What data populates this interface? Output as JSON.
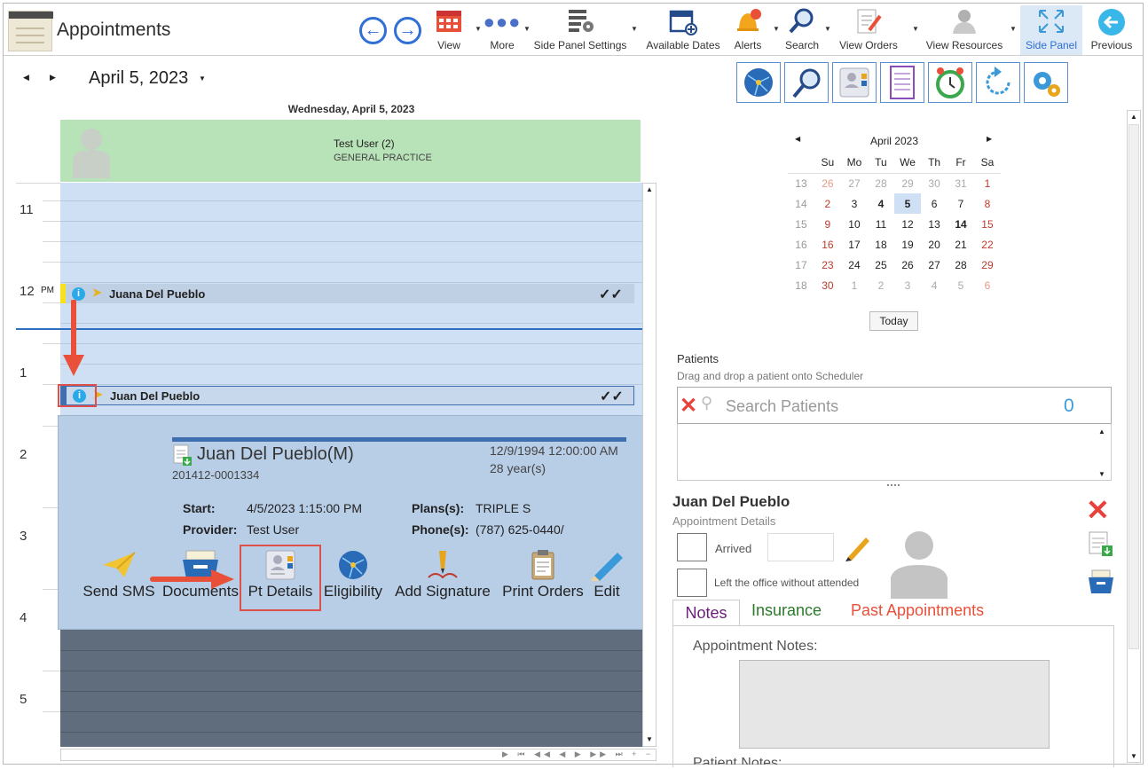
{
  "window": {
    "title": "Appointments"
  },
  "toolbar": {
    "items": [
      {
        "label": "View",
        "icon": "calendar-grid-icon"
      },
      {
        "label": "More",
        "icon": "more-dots-icon"
      },
      {
        "label": "Side Panel Settings",
        "icon": "grid-gear-icon"
      },
      {
        "label": "Available Dates",
        "icon": "calendar-add-icon"
      },
      {
        "label": "Alerts",
        "icon": "bell-icon"
      },
      {
        "label": "Search",
        "icon": "search-icon"
      },
      {
        "label": "View Orders",
        "icon": "document-edit-icon"
      },
      {
        "label": "View Resources",
        "icon": "person-icon"
      },
      {
        "label": "Side Panel",
        "icon": "expand-icon"
      },
      {
        "label": "Previous",
        "icon": "back-circle-icon"
      }
    ]
  },
  "calendar": {
    "date": "April 5, 2023",
    "day_header": "Wednesday, April 5, 2023",
    "resource_name": "Test User (2)",
    "resource_dept": "GENERAL PRACTICE",
    "hours": [
      "11",
      "12",
      "PM",
      "1",
      "2",
      "3",
      "4",
      "5"
    ],
    "appointments": [
      {
        "name": "Juana Del Pueblo",
        "check": "✓✓",
        "info": "i"
      },
      {
        "name": "Juan Del Pueblo",
        "check": "✓✓",
        "info": "i"
      }
    ]
  },
  "popup": {
    "patient": "Juan Del Pueblo(M)",
    "id": "201412-0001334",
    "dob": "12/9/1994 12:00:00 AM",
    "age": "28 year(s)",
    "start_label": "Start:",
    "start": "4/5/2023 1:15:00 PM",
    "provider_label": "Provider:",
    "provider": "Test User",
    "plans_label": "Plans(s):",
    "plans": "TRIPLE S",
    "phone_label": "Phone(s):",
    "phone": "(787) 625-0440/",
    "actions": [
      "Send SMS",
      "Documents",
      "Pt Details",
      "Eligibility",
      "Add Signature",
      "Print Orders",
      "Edit"
    ]
  },
  "side": {
    "mini_cal": {
      "title": "April 2023",
      "days": [
        "Su",
        "Mo",
        "Tu",
        "We",
        "Th",
        "Fr",
        "Sa"
      ],
      "weeks": [
        {
          "wk": "13",
          "days": [
            "26",
            "27",
            "28",
            "29",
            "30",
            "31",
            "1"
          ]
        },
        {
          "wk": "14",
          "days": [
            "2",
            "3",
            "4",
            "5",
            "6",
            "7",
            "8"
          ]
        },
        {
          "wk": "15",
          "days": [
            "9",
            "10",
            "11",
            "12",
            "13",
            "14",
            "15"
          ]
        },
        {
          "wk": "16",
          "days": [
            "16",
            "17",
            "18",
            "19",
            "20",
            "21",
            "22"
          ]
        },
        {
          "wk": "17",
          "days": [
            "23",
            "24",
            "25",
            "26",
            "27",
            "28",
            "29"
          ]
        },
        {
          "wk": "18",
          "days": [
            "30",
            "1",
            "2",
            "3",
            "4",
            "5",
            "6"
          ]
        }
      ],
      "today_button": "Today"
    },
    "patients_title": "Patients",
    "patients_hint": "Drag and drop a patient onto Scheduler",
    "search_placeholder": "Search Patients",
    "search_count": "0",
    "detail_name": "Juan Del Pueblo",
    "detail_sub": "Appointment Details",
    "arrived_label": "Arrived",
    "left_label": "Left the office without attended",
    "tabs": [
      "Notes",
      "Insurance",
      "Past Appointments"
    ],
    "appt_notes_label": "Appointment Notes:",
    "patient_notes_label": "Patient Notes:"
  },
  "colors": {
    "accent": "#2f7ad6",
    "popup": "#b8cde6",
    "resource_header": "#b8e2b8",
    "highlight": "#e0504a"
  }
}
